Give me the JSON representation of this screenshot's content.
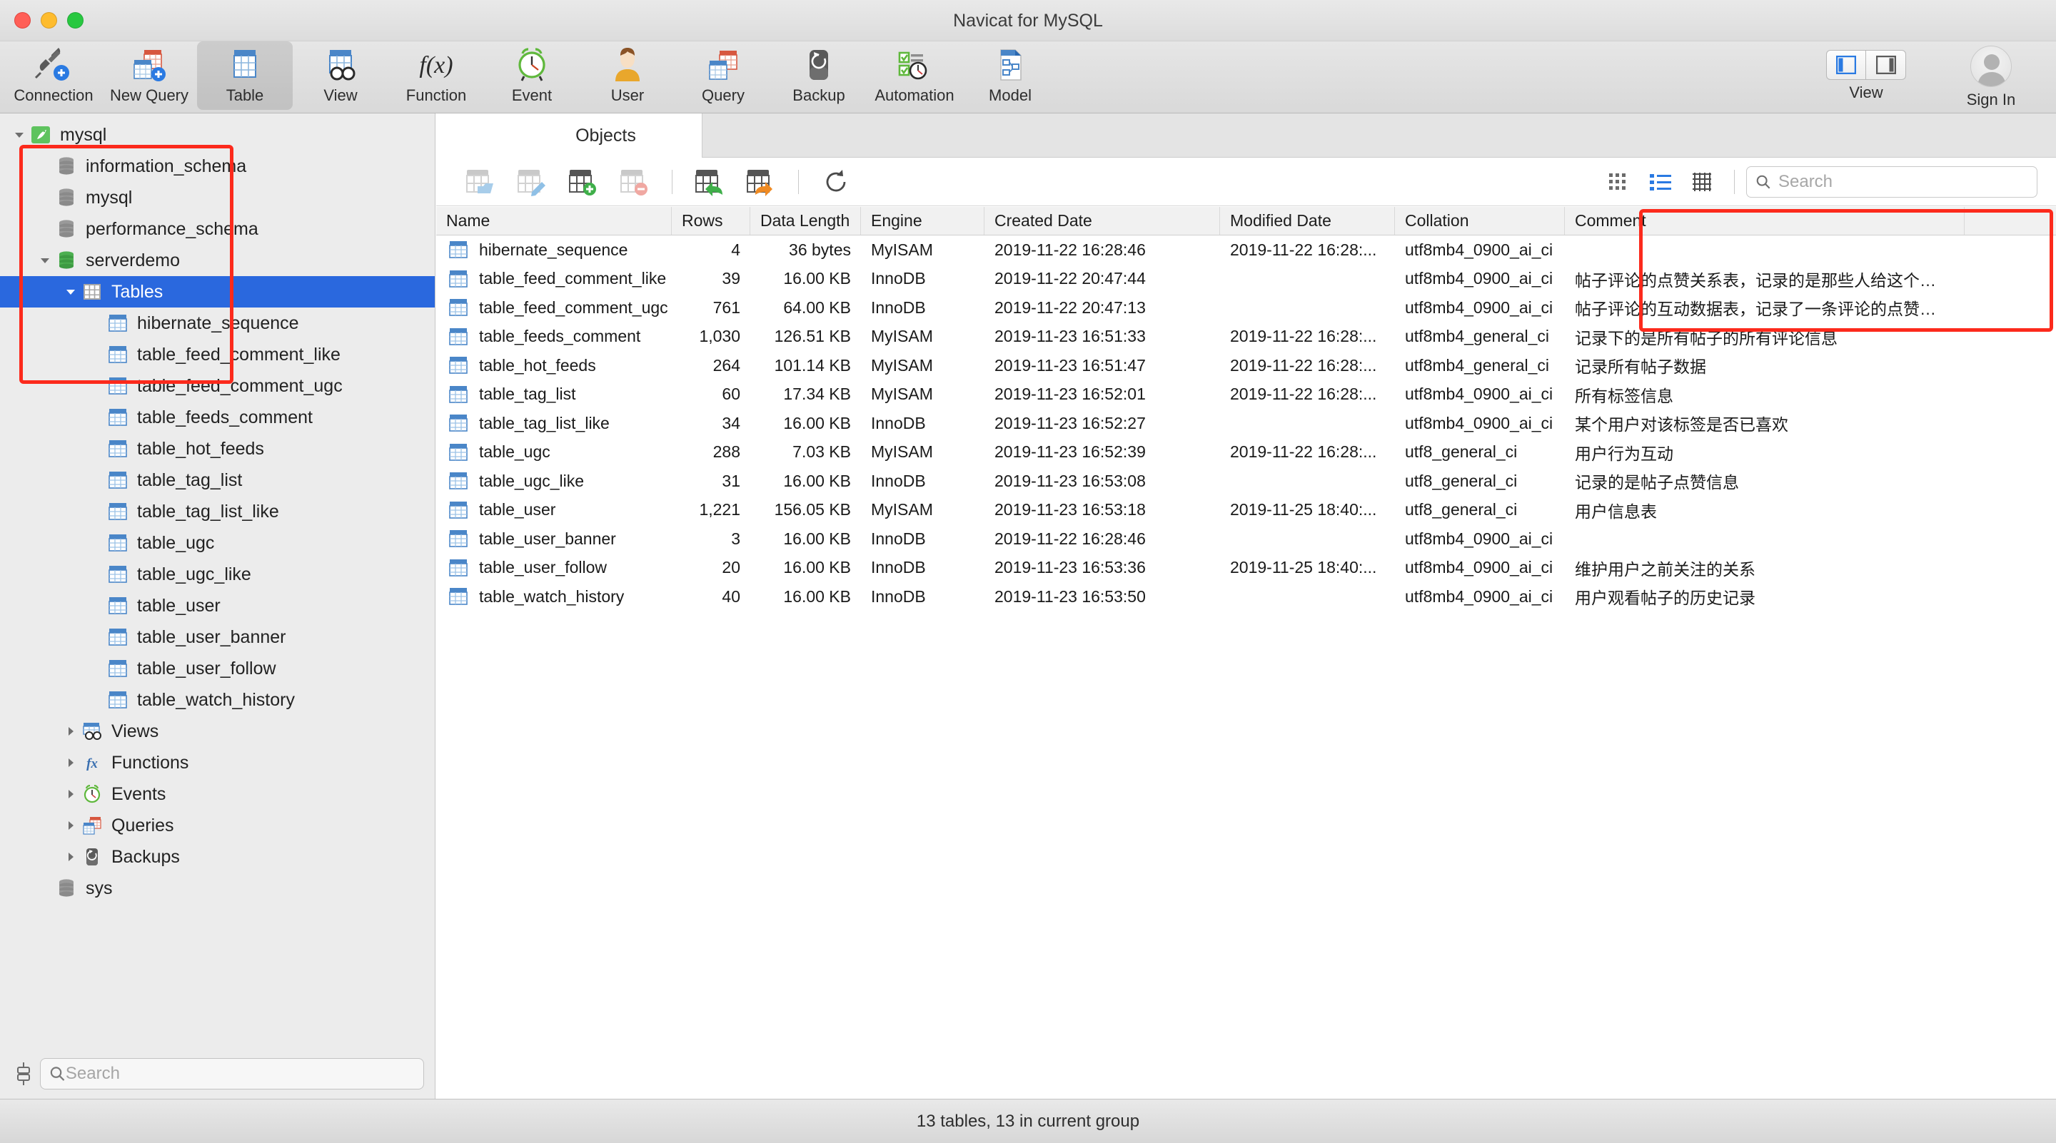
{
  "window": {
    "title": "Navicat for MySQL"
  },
  "toolbar": {
    "items": [
      {
        "label": "Connection",
        "icon": "connection-icon"
      },
      {
        "label": "New Query",
        "icon": "new-query-icon"
      },
      {
        "label": "Table",
        "icon": "table-icon",
        "active": true
      },
      {
        "label": "View",
        "icon": "view-icon"
      },
      {
        "label": "Function",
        "icon": "function-icon"
      },
      {
        "label": "Event",
        "icon": "event-icon"
      },
      {
        "label": "User",
        "icon": "user-icon"
      },
      {
        "label": "Query",
        "icon": "query-icon"
      },
      {
        "label": "Backup",
        "icon": "backup-icon"
      },
      {
        "label": "Automation",
        "icon": "automation-icon"
      },
      {
        "label": "Model",
        "icon": "model-icon"
      }
    ],
    "view_label": "View",
    "signin_label": "Sign In"
  },
  "sidebar": {
    "search_placeholder": "Search",
    "items": [
      {
        "label": "mysql",
        "depth": 0,
        "icon": "navicat-connection-icon",
        "twisty": "down"
      },
      {
        "label": "information_schema",
        "depth": 1,
        "icon": "database-gray-icon",
        "twisty": "none"
      },
      {
        "label": "mysql",
        "depth": 1,
        "icon": "database-gray-icon",
        "twisty": "none"
      },
      {
        "label": "performance_schema",
        "depth": 1,
        "icon": "database-gray-icon",
        "twisty": "none"
      },
      {
        "label": "serverdemo",
        "depth": 1,
        "icon": "database-green-icon",
        "twisty": "down"
      },
      {
        "label": "Tables",
        "depth": 2,
        "icon": "tables-folder-icon",
        "twisty": "down",
        "selected": true
      },
      {
        "label": "hibernate_sequence",
        "depth": 3,
        "icon": "table-blue-icon",
        "twisty": "none"
      },
      {
        "label": "table_feed_comment_like",
        "depth": 3,
        "icon": "table-blue-icon",
        "twisty": "none"
      },
      {
        "label": "table_feed_comment_ugc",
        "depth": 3,
        "icon": "table-blue-icon",
        "twisty": "none"
      },
      {
        "label": "table_feeds_comment",
        "depth": 3,
        "icon": "table-blue-icon",
        "twisty": "none"
      },
      {
        "label": "table_hot_feeds",
        "depth": 3,
        "icon": "table-blue-icon",
        "twisty": "none"
      },
      {
        "label": "table_tag_list",
        "depth": 3,
        "icon": "table-blue-icon",
        "twisty": "none"
      },
      {
        "label": "table_tag_list_like",
        "depth": 3,
        "icon": "table-blue-icon",
        "twisty": "none"
      },
      {
        "label": "table_ugc",
        "depth": 3,
        "icon": "table-blue-icon",
        "twisty": "none"
      },
      {
        "label": "table_ugc_like",
        "depth": 3,
        "icon": "table-blue-icon",
        "twisty": "none"
      },
      {
        "label": "table_user",
        "depth": 3,
        "icon": "table-blue-icon",
        "twisty": "none"
      },
      {
        "label": "table_user_banner",
        "depth": 3,
        "icon": "table-blue-icon",
        "twisty": "none"
      },
      {
        "label": "table_user_follow",
        "depth": 3,
        "icon": "table-blue-icon",
        "twisty": "none"
      },
      {
        "label": "table_watch_history",
        "depth": 3,
        "icon": "table-blue-icon",
        "twisty": "none"
      },
      {
        "label": "Views",
        "depth": 2,
        "icon": "views-icon",
        "twisty": "right"
      },
      {
        "label": "Functions",
        "depth": 2,
        "icon": "functions-icon",
        "twisty": "right"
      },
      {
        "label": "Events",
        "depth": 2,
        "icon": "events-icon",
        "twisty": "right"
      },
      {
        "label": "Queries",
        "depth": 2,
        "icon": "queries-icon",
        "twisty": "right"
      },
      {
        "label": "Backups",
        "depth": 2,
        "icon": "backups-icon",
        "twisty": "right"
      },
      {
        "label": "sys",
        "depth": 1,
        "icon": "database-gray-icon",
        "twisty": "none"
      }
    ]
  },
  "main": {
    "tab_label": "Objects",
    "object_toolbar": [
      {
        "name": "open-table-button",
        "icon": "table-open-icon",
        "enabled": false
      },
      {
        "name": "design-table-button",
        "icon": "table-edit-icon",
        "enabled": false
      },
      {
        "name": "new-table-button",
        "icon": "table-add-icon",
        "enabled": true
      },
      {
        "name": "delete-table-button",
        "icon": "table-delete-icon",
        "enabled": false
      },
      {
        "name": "import-wizard-button",
        "icon": "table-import-icon",
        "enabled": true
      },
      {
        "name": "export-wizard-button",
        "icon": "table-export-icon",
        "enabled": true
      },
      {
        "name": "refresh-button",
        "icon": "refresh-icon",
        "enabled": true
      }
    ],
    "view_modes": [
      "grid-view-icon",
      "list-view-icon",
      "detail-view-icon"
    ],
    "search_placeholder": "Search",
    "columns": [
      "Name",
      "Rows",
      "Data Length",
      "Engine",
      "Created Date",
      "Modified Date",
      "Collation",
      "Comment"
    ],
    "rows": [
      {
        "name": "hibernate_sequence",
        "rows": "4",
        "length": "36 bytes",
        "engine": "MyISAM",
        "created": "2019-11-22 16:28:46",
        "modified": "2019-11-22 16:28:...",
        "collation": "utf8mb4_0900_ai_ci",
        "comment": ""
      },
      {
        "name": "table_feed_comment_like",
        "rows": "39",
        "length": "16.00 KB",
        "engine": "InnoDB",
        "created": "2019-11-22 20:47:44",
        "modified": "",
        "collation": "utf8mb4_0900_ai_ci",
        "comment": "帖子评论的点赞关系表，记录的是那些人给这个…"
      },
      {
        "name": "table_feed_comment_ugc",
        "rows": "761",
        "length": "64.00 KB",
        "engine": "InnoDB",
        "created": "2019-11-22 20:47:13",
        "modified": "",
        "collation": "utf8mb4_0900_ai_ci",
        "comment": "帖子评论的互动数据表，记录了一条评论的点赞…"
      },
      {
        "name": "table_feeds_comment",
        "rows": "1,030",
        "length": "126.51 KB",
        "engine": "MyISAM",
        "created": "2019-11-23 16:51:33",
        "modified": "2019-11-22 16:28:...",
        "collation": "utf8mb4_general_ci",
        "comment": "记录下的是所有帖子的所有评论信息"
      },
      {
        "name": "table_hot_feeds",
        "rows": "264",
        "length": "101.14 KB",
        "engine": "MyISAM",
        "created": "2019-11-23 16:51:47",
        "modified": "2019-11-22 16:28:...",
        "collation": "utf8mb4_general_ci",
        "comment": "记录所有帖子数据"
      },
      {
        "name": "table_tag_list",
        "rows": "60",
        "length": "17.34 KB",
        "engine": "MyISAM",
        "created": "2019-11-23 16:52:01",
        "modified": "2019-11-22 16:28:...",
        "collation": "utf8mb4_0900_ai_ci",
        "comment": "所有标签信息"
      },
      {
        "name": "table_tag_list_like",
        "rows": "34",
        "length": "16.00 KB",
        "engine": "InnoDB",
        "created": "2019-11-23 16:52:27",
        "modified": "",
        "collation": "utf8mb4_0900_ai_ci",
        "comment": "某个用户对该标签是否已喜欢"
      },
      {
        "name": "table_ugc",
        "rows": "288",
        "length": "7.03 KB",
        "engine": "MyISAM",
        "created": "2019-11-23 16:52:39",
        "modified": "2019-11-22 16:28:...",
        "collation": "utf8_general_ci",
        "comment": "用户行为互动"
      },
      {
        "name": "table_ugc_like",
        "rows": "31",
        "length": "16.00 KB",
        "engine": "InnoDB",
        "created": "2019-11-23 16:53:08",
        "modified": "",
        "collation": "utf8_general_ci",
        "comment": "记录的是帖子点赞信息"
      },
      {
        "name": "table_user",
        "rows": "1,221",
        "length": "156.05 KB",
        "engine": "MyISAM",
        "created": "2019-11-23 16:53:18",
        "modified": "2019-11-25 18:40:...",
        "collation": "utf8_general_ci",
        "comment": "用户信息表"
      },
      {
        "name": "table_user_banner",
        "rows": "3",
        "length": "16.00 KB",
        "engine": "InnoDB",
        "created": "2019-11-22 16:28:46",
        "modified": "",
        "collation": "utf8mb4_0900_ai_ci",
        "comment": ""
      },
      {
        "name": "table_user_follow",
        "rows": "20",
        "length": "16.00 KB",
        "engine": "InnoDB",
        "created": "2019-11-23 16:53:36",
        "modified": "2019-11-25 18:40:...",
        "collation": "utf8mb4_0900_ai_ci",
        "comment": "维护用户之前关注的关系"
      },
      {
        "name": "table_watch_history",
        "rows": "40",
        "length": "16.00 KB",
        "engine": "InnoDB",
        "created": "2019-11-23 16:53:50",
        "modified": "",
        "collation": "utf8mb4_0900_ai_ci",
        "comment": "用户观看帖子的历史记录"
      }
    ]
  },
  "statusbar": {
    "text": "13 tables, 13 in current group"
  },
  "colors": {
    "selection": "#2a68de",
    "annotation": "#fc2a1c",
    "table_blue": "#4a86c8",
    "accent_green": "#3fb349"
  }
}
